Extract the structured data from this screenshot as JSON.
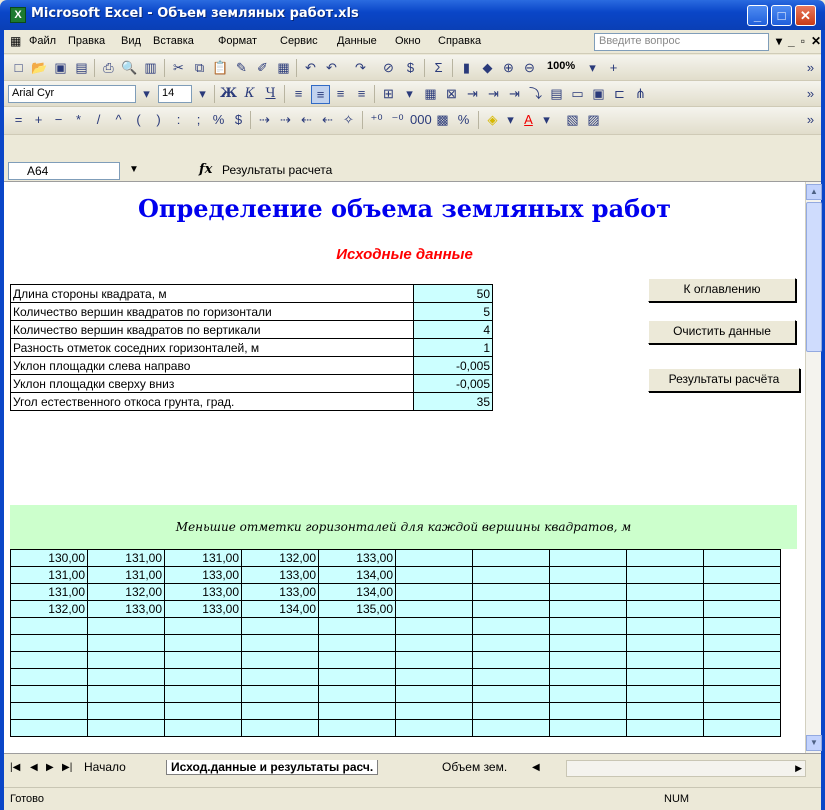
{
  "window": {
    "title": "Microsoft Excel - Объем земляных работ.xls"
  },
  "menu": {
    "items": [
      "Файл",
      "Правка",
      "Вид",
      "Вставка",
      "Формат",
      "Сервис",
      "Данные",
      "Окно",
      "Справка"
    ],
    "help_placeholder": "Введите вопрос"
  },
  "toolbar": {
    "zoom": "100%",
    "font_name": "Arial Cyr",
    "font_size": "14",
    "bold": "Ж",
    "italic": "К",
    "underline": "Ч"
  },
  "formula_bar": {
    "name_box": "A64",
    "fx": "fx",
    "formula": "Результаты расчета"
  },
  "sheet": {
    "heading": "Определение объема земляных работ",
    "subheading": "Исходные данные",
    "params": [
      {
        "label": "Длина стороны квадрата, м",
        "value": "50"
      },
      {
        "label": "Количество вершин квадратов по горизонтали",
        "value": "5"
      },
      {
        "label": "Количество вершин квадратов по вертикали",
        "value": "4"
      },
      {
        "label": "Разность отметок соседних горизонталей, м",
        "value": "1"
      },
      {
        "label": "Уклон площадки слева направо",
        "value": "-0,005"
      },
      {
        "label": "Уклон площадки сверху вниз",
        "value": "-0,005"
      },
      {
        "label": "Угол естественного откоса грунта, град.",
        "value": "35"
      }
    ],
    "buttons": {
      "toc": "К оглавлению",
      "clear": "Очистить данные",
      "results": "Результаты расчёта"
    },
    "grid_title": "Меньшие отметки горизонталей для каждой вершины квадратов, м",
    "grid_rows": [
      [
        "130,00",
        "131,00",
        "131,00",
        "132,00",
        "133,00"
      ],
      [
        "131,00",
        "131,00",
        "133,00",
        "133,00",
        "134,00"
      ],
      [
        "131,00",
        "132,00",
        "133,00",
        "133,00",
        "134,00"
      ],
      [
        "132,00",
        "133,00",
        "133,00",
        "134,00",
        "135,00"
      ]
    ]
  },
  "tabs": [
    "Начало",
    "Исход.данные и результаты расч.",
    "Объем зем."
  ],
  "status": {
    "left": "Готово",
    "num": "NUM"
  }
}
